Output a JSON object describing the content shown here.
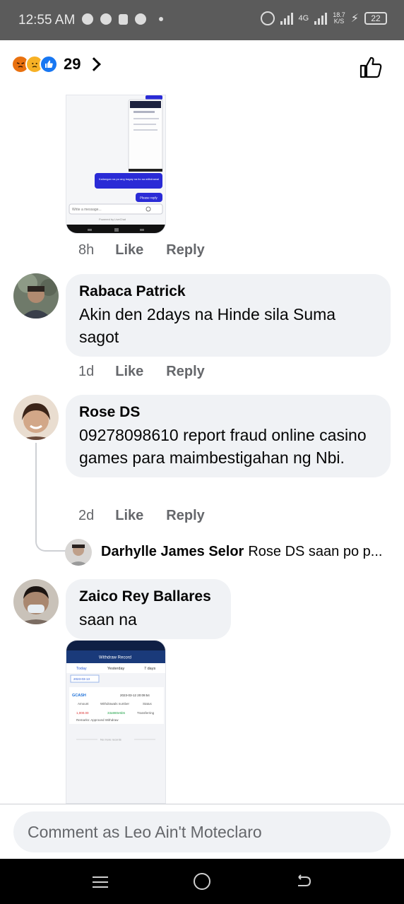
{
  "status_bar": {
    "time": "12:55 AM",
    "network": "4G",
    "speed_value": "18.7",
    "speed_unit": "K/S",
    "battery": "22"
  },
  "reactions": {
    "types": [
      "angry",
      "sad",
      "like"
    ],
    "count": "29"
  },
  "comments": [
    {
      "author": "Rabaca Patrick",
      "text": "Akin  den 2days na Hinde sila Suma sagot",
      "time": "1d",
      "like_label": "Like",
      "reply_label": "Reply"
    },
    {
      "author": "Rose DS",
      "text": "09278098610 report fraud online casino games para maimbestigahan ng Nbi.",
      "time": "2d",
      "like_label": "Like",
      "reply_label": "Reply"
    },
    {
      "author": "Zaico Rey Ballares",
      "text": "saan na"
    }
  ],
  "first_image_actions": {
    "time": "8h",
    "like_label": "Like",
    "reply_label": "Reply"
  },
  "reply_preview": {
    "author": "Darhylle James Selor",
    "text": "Rose DS saan po p..."
  },
  "screenshot1": {
    "chat_placeholder": "Write a message...",
    "bubble_top": "Kailangan na po ang bagay na ito sa withdrawal",
    "bubble_bottom": "Please reply",
    "powered_by": "Powered by LiveChat"
  },
  "screenshot2": {
    "header": "Withdraw Record",
    "tabs": [
      "Today",
      "Yesterday",
      "7 days"
    ],
    "date_chip": "2023-03-13",
    "provider": "GCASH",
    "record_time": "2023-03-12 20:09:54",
    "col_amount": "Amount",
    "col_withdrawal": "Withdrawals number",
    "col_status": "Status",
    "amount": "1,000.00",
    "number": "33a980e5b5",
    "status": "Transferring",
    "remarks": "Remarks: Approved Withdraw",
    "no_more": "No more records"
  },
  "composer": {
    "placeholder": "Comment as Leo Ain't Moteclaro"
  },
  "colors": {
    "status_bar": "#5b5b5b",
    "bubble": "#f0f2f5",
    "meta_text": "#65676b",
    "like_blue": "#1877f2",
    "nav_bar": "#000000"
  }
}
